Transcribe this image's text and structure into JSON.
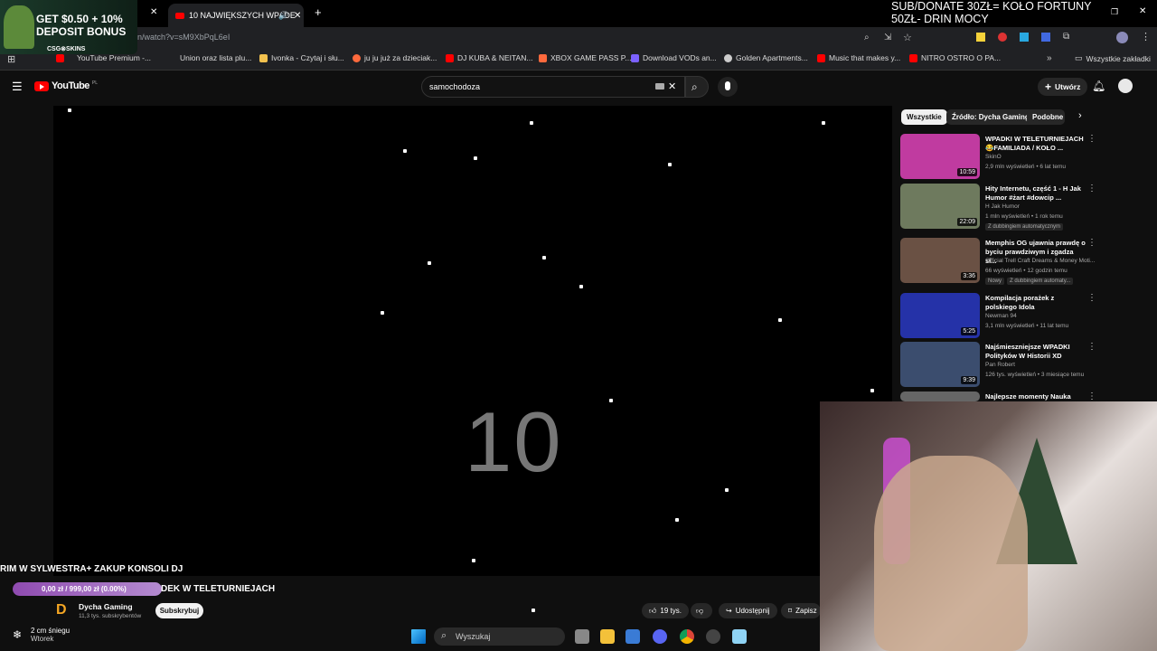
{
  "promo": {
    "line1": "GET $0.50 + 10%",
    "line2": "DEPOSIT BONUS",
    "brand": "CSG⊗SKINS"
  },
  "stream_overlay": {
    "line1": "SUB/DONATE 30ZŁ= KOŁO FORTUNY",
    "line2": "50ZŁ- DRIN MOCY"
  },
  "tabs": [
    {
      "label": "10 NAJWIĘKSZYCH WPADE"
    }
  ],
  "address": {
    "url": "n/watch?v=sM9XbPqL6eI"
  },
  "bookmarks": [
    {
      "label": "YouTube Premium -...",
      "color": "#ff0000"
    },
    {
      "label": "Union oraz lista plu...",
      "color": "#555555"
    },
    {
      "label": "Ivonka - Czytaj i słu...",
      "color": "#f2c14e"
    },
    {
      "label": "ju ju już za dzieciak...",
      "color": "#ff6a3d"
    },
    {
      "label": "DJ KUBA & NEITAN...",
      "color": "#ff0000"
    },
    {
      "label": "XBOX GAME PASS P...",
      "color": "#ff6a3d"
    },
    {
      "label": "Download VODs an...",
      "color": "#7b61ff"
    },
    {
      "label": "Golden Apartments...",
      "color": "#cccccc"
    },
    {
      "label": "Music that makes y...",
      "color": "#ff0000"
    },
    {
      "label": "NITRO OSTRO O PA...",
      "color": "#ff0000"
    },
    {
      "label": "Wszystkie zakładki",
      "color": "#aaaaaa"
    }
  ],
  "yt": {
    "logo": "YouTube",
    "logo_suffix": "PL",
    "search_value": "samochodoza",
    "create_label": "Utwórz"
  },
  "video": {
    "overlay_number": "10"
  },
  "ticker": {
    "text": "RIM W SYLWESTRA+ ZAKUP KONSOLI DJ"
  },
  "goal": {
    "text": "0,00 zł / 999,00 zł (0.00%)"
  },
  "video_title": "DEK W TELETURNIEJACH",
  "channel": {
    "name": "Dycha Gaming",
    "subs": "11,3 tys. subskrybentów",
    "subscribe": "Subskrybuj"
  },
  "actions": {
    "likes": "19 tys.",
    "share": "Udostępnij",
    "save": "Zapisz"
  },
  "chips": [
    "Wszystkie",
    "Źródło: Dycha Gaming",
    "Podobne"
  ],
  "recommendations": [
    {
      "title": "WPADKI W TELETURNIEJACH 😂FAMILIADA / KOŁO ...",
      "channel": "SkinO",
      "meta": "2,9 mln wyświetleń • 6 lat temu",
      "duration": "10:59",
      "color": "#c03ba0"
    },
    {
      "title": "Hity Internetu, część 1 - H Jak Humor #żart #dowcip ...",
      "channel": "H Jak Humor",
      "meta": "1 mln wyświetleń • 1 rok temu",
      "badge": "Z dubbingiem automatycznym",
      "duration": "22:09",
      "color": "#6e7a5e"
    },
    {
      "title": "Memphis OG ujawnia prawdę o byciu prawdziwym i zgadza si...",
      "channel": "Official Trell Craft Dreams & Money Moti...",
      "meta": "66 wyświetleń • 12 godzin temu",
      "badge": "Z dubbingiem automaty...",
      "badge2": "Nowy",
      "duration": "3:36",
      "color": "#6a5144"
    },
    {
      "title": "Kompilacja porażek z polskiego Idola",
      "channel": "Newman 94",
      "meta": "3,1 mln wyświetleń • 11 lat temu",
      "duration": "5:25",
      "color": "#2532a8"
    },
    {
      "title": "Najśmieszniejsze WPADKI Polityków W Historii XD",
      "channel": "Pan Robert",
      "meta": "126 tys. wyświetleń • 3 miesiące temu",
      "duration": "9:39",
      "color": "#3b4d6e"
    },
    {
      "title": "Najlepsze momenty Nauka",
      "channel": "",
      "meta": "",
      "duration": "",
      "color": "#666666"
    }
  ],
  "taskbar": {
    "weather_temp": "2 cm śniegu",
    "weather_day": "Wtorek",
    "search_placeholder": "Wyszukaj"
  }
}
